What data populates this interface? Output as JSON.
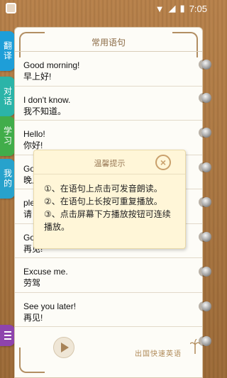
{
  "status_bar": {
    "time": "7:05"
  },
  "page": {
    "title": "常用语句"
  },
  "tabs": [
    {
      "label": "翻译"
    },
    {
      "label": "对话"
    },
    {
      "label": "学习"
    },
    {
      "label": "我的"
    }
  ],
  "phrases": [
    {
      "en": "Good morning!",
      "zh": "早上好!"
    },
    {
      "en": "I don't know.",
      "zh": "我不知道。"
    },
    {
      "en": "Hello!",
      "zh": "你好!"
    },
    {
      "en": "Go",
      "zh": "晚上"
    },
    {
      "en": "ple",
      "zh": "请"
    },
    {
      "en": "Go",
      "zh": "再见!"
    },
    {
      "en": "Excuse me.",
      "zh": "劳驾"
    },
    {
      "en": "See you later!",
      "zh": "再见!"
    }
  ],
  "dialog": {
    "title": "温馨提示",
    "tip1": "①、在语句上点击可发音朗读。",
    "tip2": "②、在语句上长按可重复播放。",
    "tip3a": "③、点击屏幕下方播放按钮可连续",
    "tip3b": "播放。"
  },
  "brand": {
    "logo_text": "出国快速英语"
  },
  "colors": {
    "translate_tab": "#1e9ed8",
    "dialog_tab": "#2bb4a8",
    "study_tab": "#41ad4a",
    "mine_tab": "#27a2cc",
    "menu_tab": "#8e44ad"
  }
}
